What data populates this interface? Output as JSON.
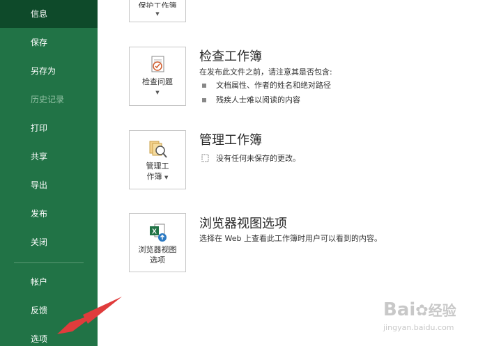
{
  "sidebar": {
    "items": [
      {
        "label": "信息"
      },
      {
        "label": "保存"
      },
      {
        "label": "另存为"
      },
      {
        "label": "历史记录"
      },
      {
        "label": "打印"
      },
      {
        "label": "共享"
      },
      {
        "label": "导出"
      },
      {
        "label": "发布"
      },
      {
        "label": "关闭"
      },
      {
        "label": "帐户"
      },
      {
        "label": "反馈"
      },
      {
        "label": "选项"
      }
    ],
    "active_item": "信息",
    "disabled_item": "历史记录",
    "background_color": "#217346",
    "active_color": "#0e4a2a"
  },
  "partial_top_button": {
    "label": "保护工作簿"
  },
  "sections": {
    "inspect": {
      "button_label": "检查问题",
      "title": "检查工作簿",
      "description": "在发布此文件之前，请注意其是否包含:",
      "bullets": [
        "文档属性、作者的姓名和绝对路径",
        "残疾人士难以阅读的内容"
      ],
      "icon": "inspect-document-icon"
    },
    "manage": {
      "button_label_line1": "管理工",
      "button_label_line2": "作簿",
      "title": "管理工作簿",
      "status": "没有任何未保存的更改。",
      "icon": "manage-workbook-icon"
    },
    "browser": {
      "button_label_line1": "浏览器视图",
      "button_label_line2": "选项",
      "title": "浏览器视图选项",
      "description": "选择在 Web 上查看此工作簿时用户可以看到的内容。",
      "icon": "excel-browser-view-icon"
    }
  },
  "watermark": {
    "brand": "Bai",
    "brand_suffix": "经验",
    "url": "jingyan.baidu.com"
  },
  "annotation": {
    "color": "#e03c3c",
    "icon": "red-arrow-pointer"
  }
}
